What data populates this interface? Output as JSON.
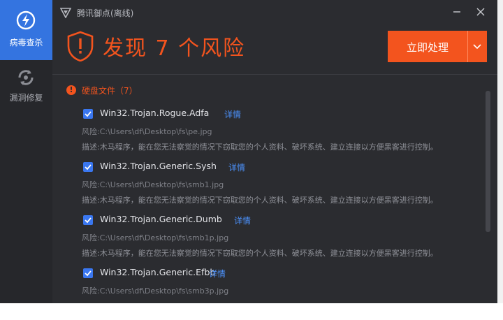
{
  "app": {
    "title": "腾讯御点(离线)"
  },
  "sidebar": {
    "items": [
      {
        "label": "病毒查杀",
        "icon": "lightning-icon",
        "active": true
      },
      {
        "label": "漏洞修复",
        "icon": "repair-icon",
        "active": false
      }
    ]
  },
  "header": {
    "headline": "发现 7 个风险",
    "action_label": "立即处理"
  },
  "section": {
    "title": "硬盘文件（7）"
  },
  "threats": [
    {
      "name": "Win32.Trojan.Rogue.Adfa",
      "detail": "详情",
      "path": "风险:C:\\Users\\df\\Desktop\\fs\\pe.jpg",
      "desc": "描述:木马程序，能在您无法察觉的情况下窃取您的个人资料、破坏系统、建立连接以方便黑客进行控制。"
    },
    {
      "name": "Win32.Trojan.Generic.Sysh",
      "detail": "详情",
      "path": "风险:C:\\Users\\df\\Desktop\\fs\\smb1.jpg",
      "desc": "描述:木马程序，能在您无法察觉的情况下窃取您的个人资料、破坏系统、建立连接以方便黑客进行控制。"
    },
    {
      "name": "Win32.Trojan.Generic.Dumb",
      "detail": "详情",
      "path": "风险:C:\\Users\\df\\Desktop\\fs\\smb1p.jpg",
      "desc": "描述:木马程序，能在您无法察觉的情况下窃取您的个人资料、破坏系统、建立连接以方便黑客进行控制。"
    },
    {
      "name": "Win32.Trojan.Generic.Efbb",
      "detail": "详情",
      "path": "风险:C:\\Users\\df\\Desktop\\fs\\smb3p.jpg",
      "desc": ""
    }
  ],
  "colors": {
    "accent": "#f3541e",
    "link": "#4b8ff7",
    "active_nav": "#3474e0",
    "background": "#2b2c30"
  }
}
